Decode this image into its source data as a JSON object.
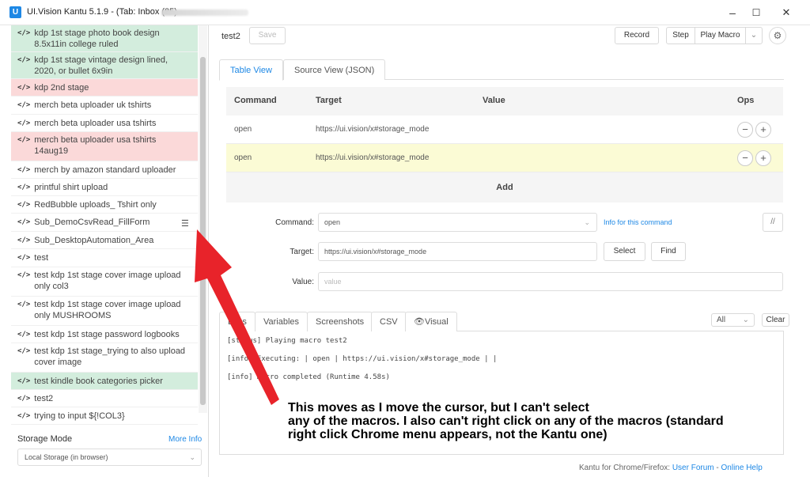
{
  "window": {
    "title": "UI.Vision Kantu 5.1.9 - (Tab: Inbox (85) - ",
    "app_icon": "U",
    "minimize": "–",
    "maximize": "☐",
    "close": "✕"
  },
  "sidebar": {
    "macros": [
      {
        "name": "kdp 1st stage photo book design 8.5x11in college ruled",
        "state": "green"
      },
      {
        "name": "kdp 1st stage vintage design lined, 2020, or bullet 6x9in",
        "state": "green"
      },
      {
        "name": "kdp 2nd stage",
        "state": "red"
      },
      {
        "name": "merch beta uploader uk tshirts",
        "state": "none"
      },
      {
        "name": "merch beta uploader usa tshirts",
        "state": "none"
      },
      {
        "name": "merch beta uploader usa tshirts 14aug19",
        "state": "red"
      },
      {
        "name": "merch by amazon standard uploader",
        "state": "none"
      },
      {
        "name": "printful shirt upload",
        "state": "none"
      },
      {
        "name": "RedBubble uploads_ Tshirt only",
        "state": "none"
      },
      {
        "name": "Sub_DemoCsvRead_FillForm",
        "state": "none"
      },
      {
        "name": "Sub_DesktopAutomation_Area",
        "state": "none"
      },
      {
        "name": "test",
        "state": "none"
      },
      {
        "name": "test kdp 1st stage cover image upload only col3",
        "state": "none"
      },
      {
        "name": "test kdp 1st stage cover image upload only MUSHROOMS",
        "state": "none"
      },
      {
        "name": "test kdp 1st stage password logbooks",
        "state": "none"
      },
      {
        "name": "test kdp 1st stage_trying to also upload cover image",
        "state": "none"
      },
      {
        "name": "test kindle book categories picker",
        "state": "green"
      },
      {
        "name": "test2",
        "state": "none"
      },
      {
        "name": "trying to input ${!COL3}",
        "state": "none"
      }
    ],
    "code_glyph": "</>",
    "storage_label": "Storage Mode",
    "more_info": "More Info",
    "storage_value": "Local Storage (in browser)"
  },
  "toolbar": {
    "macro_name": "test2",
    "save": "Save",
    "record": "Record",
    "step": "Step",
    "play_macro": "Play Macro",
    "dropdown": "⌄",
    "settings_icon": "⚙"
  },
  "tabs": {
    "table_view": "Table View",
    "source_view": "Source View (JSON)"
  },
  "table": {
    "headers": [
      "Command",
      "Target",
      "Value",
      "Ops"
    ],
    "rows": [
      {
        "command": "open",
        "target": "https://ui.vision/x#storage_mode",
        "value": "",
        "highlight": false
      },
      {
        "command": "open",
        "target": "https://ui.vision/x#storage_mode",
        "value": "",
        "highlight": true
      }
    ],
    "minus": "−",
    "plus": "+",
    "add": "Add"
  },
  "form": {
    "command_label": "Command:",
    "command_value": "open",
    "info_link": "Info for this command",
    "comment_btn": "//",
    "target_label": "Target:",
    "target_value": "https://ui.vision/x#storage_mode",
    "select": "Select",
    "find": "Find",
    "value_label": "Value:",
    "value_placeholder": "value"
  },
  "logs": {
    "tabs": [
      "Logs",
      "Variables",
      "Screenshots",
      "CSV",
      "👁Visual"
    ],
    "filter": "All",
    "clear": "Clear",
    "lines": [
      "[status]  Playing macro test2",
      "[info]  Executing:  | open | https://ui.vision/x#storage_mode |  |",
      "[info]  Macro completed (Runtime 4.58s)"
    ]
  },
  "footer": {
    "prefix": "Kantu for Chrome/Firefox: ",
    "forum": "User Forum",
    "sep": " - ",
    "help": "Online Help"
  },
  "annotation": {
    "line1": "This moves as I move the cursor, but I can't select",
    "line2": "any of the macros. I also can't right click on any of the macros (standard",
    "line3": "right click Chrome menu appears, not the Kantu one)",
    "arrow_color": "#e8232a"
  },
  "colors": {
    "accent": "#1e88e5",
    "green_row": "#d3eddd",
    "red_row": "#fbd9d9",
    "yellow_row": "#fbfbd5"
  }
}
